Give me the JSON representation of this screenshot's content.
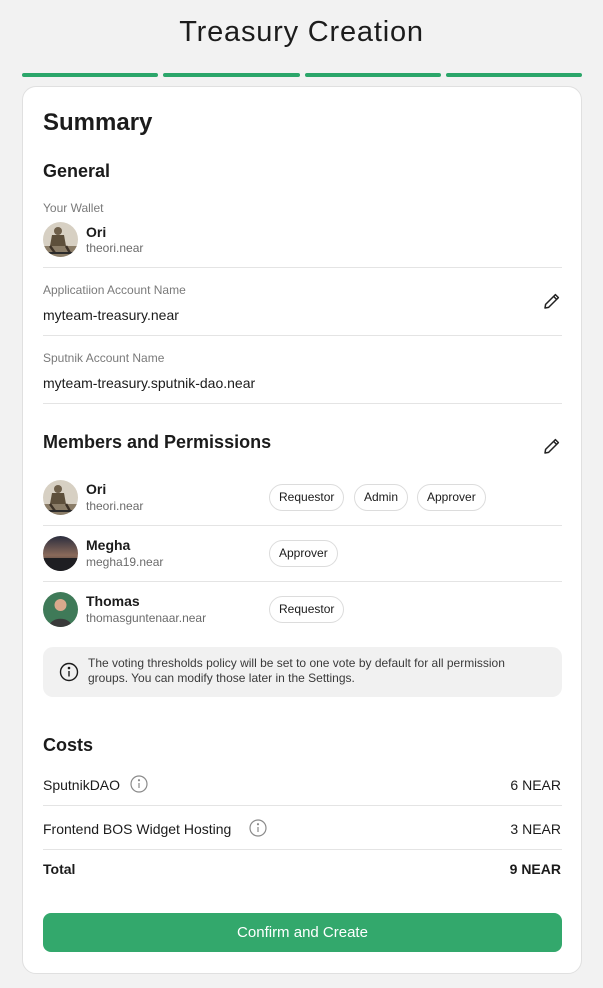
{
  "page": {
    "title": "Treasury Creation"
  },
  "progress": {
    "steps_total": 4,
    "steps_completed": 4,
    "color": "#2ba66a"
  },
  "summary": {
    "title": "Summary",
    "general": {
      "title": "General",
      "wallet": {
        "label": "Your Wallet",
        "name": "Ori",
        "account": "theori.near"
      },
      "application_account": {
        "label": "Applicatiion Account Name",
        "value": "myteam-treasury.near"
      },
      "sputnik_account": {
        "label": "Sputnik Account Name",
        "value": "myteam-treasury.sputnik-dao.near"
      }
    },
    "members": {
      "title": "Members and Permissions",
      "list": [
        {
          "name": "Ori",
          "account": "theori.near",
          "roles": [
            "Requestor",
            "Admin",
            "Approver"
          ]
        },
        {
          "name": "Megha",
          "account": "megha19.near",
          "roles": [
            "Approver"
          ]
        },
        {
          "name": "Thomas",
          "account": "thomasguntenaar.near",
          "roles": [
            "Requestor"
          ]
        }
      ],
      "note": "The voting thresholds policy will be set to one vote by default for all permission groups. You can modify those later in the Settings."
    },
    "costs": {
      "title": "Costs",
      "items": [
        {
          "label": "SputnikDAO",
          "value": "6 NEAR"
        },
        {
          "label": "Frontend BOS Widget Hosting",
          "value": "3 NEAR"
        }
      ],
      "total": {
        "label": "Total",
        "value": "9 NEAR"
      }
    },
    "confirm_label": "Confirm and Create"
  },
  "icons": {
    "edit": "pencil-icon",
    "info": "info-icon"
  },
  "colors": {
    "accent": "#33a86c",
    "card": "#ffffff",
    "background": "#f2f2f2"
  }
}
